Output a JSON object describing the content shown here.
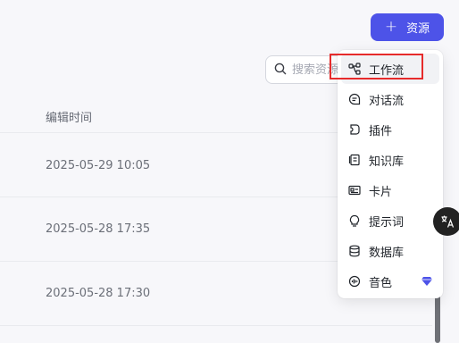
{
  "toolbar": {
    "add_label": "资源",
    "add_icon": "plus-icon"
  },
  "search": {
    "placeholder": "搜索资源",
    "icon": "search-icon"
  },
  "table": {
    "column_header": "编辑时间",
    "rows": [
      {
        "time": "2025-05-29 10:05"
      },
      {
        "time": "2025-05-28 17:35"
      },
      {
        "time": "2025-05-28 17:30"
      }
    ]
  },
  "menu": {
    "items": [
      {
        "label": "工作流",
        "icon": "workflow-icon",
        "active": true
      },
      {
        "label": "对话流",
        "icon": "chatflow-icon"
      },
      {
        "label": "插件",
        "icon": "plugin-icon"
      },
      {
        "label": "知识库",
        "icon": "knowledge-icon"
      },
      {
        "label": "卡片",
        "icon": "card-icon"
      },
      {
        "label": "提示词",
        "icon": "prompt-icon"
      },
      {
        "label": "数据库",
        "icon": "database-icon"
      },
      {
        "label": "音色",
        "icon": "voice-icon",
        "badge_icon": "diamond-icon",
        "badge_color": "#4d53e8"
      }
    ]
  },
  "colors": {
    "accent": "#4d53e8",
    "highlight": "#e62b2b"
  },
  "floating": {
    "icon": "translate-icon"
  }
}
